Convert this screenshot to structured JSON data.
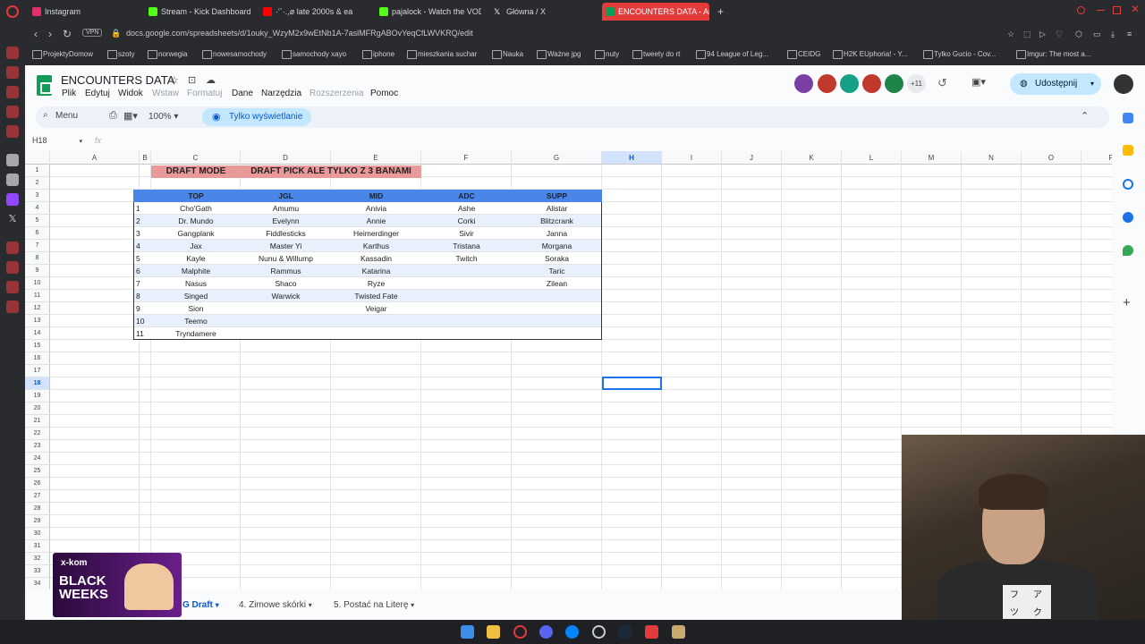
{
  "browser": {
    "tabs": [
      {
        "label": "Instagram",
        "color": "#e1306c"
      },
      {
        "label": "Stream - Kick Dashboard",
        "color": "#53fc18"
      },
      {
        "label": "·'`·.,ø late 2000s & ea",
        "color": "#ff0000"
      },
      {
        "label": "pajalock - Watch the VOD",
        "color": "#53fc18"
      },
      {
        "label": "Główna / X",
        "color": "#ffffff"
      },
      {
        "label": "ENCOUNTERS DATA - Ark",
        "color": "#0f9d58"
      }
    ],
    "new_tab": "+",
    "vpn": "VPN",
    "url": "docs.google.com/spreadsheets/d/1ouky_WzyM2x9wEtNb1A-7aslMFRgABOvYeqCfLWVKRQ/edit",
    "bookmarks": [
      "ProjektyDomow",
      "szoty",
      "norwegia",
      "nowesamochody",
      "samochody xayo",
      "iphone",
      "mieszkania suchar",
      "Nauka",
      "Ważne jpg",
      "nuty",
      "tweety do rt",
      "94 League of Leg...",
      "CEIDG",
      "H2K EUphoria! - Y...",
      "Tylko Gucio - Cov...",
      "Imgur: The most a..."
    ]
  },
  "sheets": {
    "title": "ENCOUNTERS DATA",
    "menus": [
      {
        "label": "Plik",
        "disabled": false
      },
      {
        "label": "Edytuj",
        "disabled": false
      },
      {
        "label": "Widok",
        "disabled": false
      },
      {
        "label": "Wstaw",
        "disabled": true
      },
      {
        "label": "Formatuj",
        "disabled": true
      },
      {
        "label": "Dane",
        "disabled": false
      },
      {
        "label": "Narzędzia",
        "disabled": false
      },
      {
        "label": "Rozszerzenia",
        "disabled": true
      },
      {
        "label": "Pomoc",
        "disabled": false
      }
    ],
    "collaborators_extra": "+11",
    "share_label": "Udostępnij",
    "toolbar": {
      "menu_label": "Menu",
      "zoom": "100%",
      "view_only": "Tylko wyświetlanie"
    },
    "name_box": "H18",
    "fx": "fx",
    "columns": [
      "A",
      "B",
      "C",
      "D",
      "E",
      "F",
      "G",
      "H",
      "I",
      "J",
      "K",
      "L",
      "M",
      "N",
      "O",
      "P"
    ],
    "selected_column": "H",
    "selected_row": "18",
    "row_count": 34,
    "draft_mode": "DRAFT MODE",
    "draft_pick": "DRAFT PICK ALE TYLKO Z 3 BANAMI",
    "table": {
      "headers": [
        "TOP",
        "JGL",
        "MID",
        "ADC",
        "SUPP"
      ],
      "rows": [
        [
          "1",
          "Cho'Gath",
          "Amumu",
          "Anivia",
          "Ashe",
          "Alistar"
        ],
        [
          "2",
          "Dr. Mundo",
          "Evelynn",
          "Annie",
          "Corki",
          "Blitzcrank"
        ],
        [
          "3",
          "Gangplank",
          "Fiddlesticks",
          "Heimerdinger",
          "Sivir",
          "Janna"
        ],
        [
          "4",
          "Jax",
          "Master Yi",
          "Karthus",
          "Tristana",
          "Morgana"
        ],
        [
          "5",
          "Kayle",
          "Nunu & Willump",
          "Kassadin",
          "Twitch",
          "Soraka"
        ],
        [
          "6",
          "Malphite",
          "Rammus",
          "Katarina",
          "",
          "Taric"
        ],
        [
          "7",
          "Nasus",
          "Shaco",
          "Ryze",
          "",
          "Zilean"
        ],
        [
          "8",
          "Singed",
          "Warwick",
          "Twisted Fate",
          "",
          ""
        ],
        [
          "9",
          "Sion",
          "",
          "Veigar",
          "",
          ""
        ],
        [
          "10",
          "Teemo",
          "",
          "",
          "",
          ""
        ],
        [
          "11",
          "Tryndamere",
          "",
          "",
          "",
          ""
        ]
      ]
    },
    "sheet_tabs": [
      {
        "label": "G Draft",
        "active": true
      },
      {
        "label": "4. Zimowe skórki",
        "active": false
      },
      {
        "label": "5. Postać na Literę",
        "active": false
      }
    ]
  },
  "ad": {
    "brand": "x-kom",
    "title": "BLACK WEEKS"
  },
  "webcam_card_chars": [
    "フ",
    "ア",
    "ツ",
    "ク"
  ]
}
